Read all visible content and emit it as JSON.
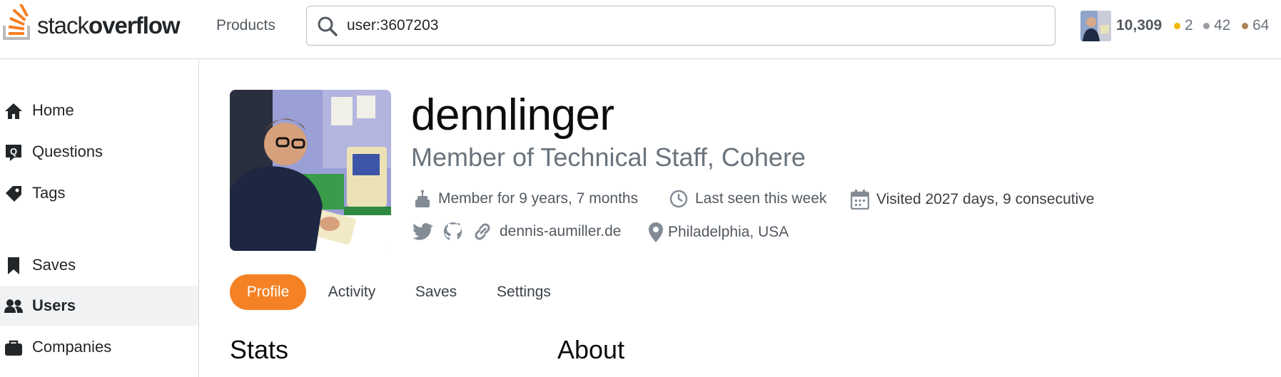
{
  "header": {
    "logo_light": "stack",
    "logo_bold": "overflow",
    "products_label": "Products",
    "search_value": "user:3607203",
    "reputation": "10,309",
    "badges": {
      "gold": "2",
      "silver": "42",
      "bronze": "64"
    }
  },
  "sidebar": {
    "items": [
      {
        "label": "Home"
      },
      {
        "label": "Questions"
      },
      {
        "label": "Tags"
      },
      {
        "label": "Saves"
      },
      {
        "label": "Users"
      },
      {
        "label": "Companies"
      }
    ]
  },
  "profile": {
    "name": "dennlinger",
    "title": "Member of Technical Staff, Cohere",
    "member_for": "Member for 9 years, 7 months",
    "last_seen": "Last seen this week",
    "visited": "Visited 2027 days, 9 consecutive",
    "website": "dennis-aumiller.de",
    "location": "Philadelphia, USA"
  },
  "tabs": [
    {
      "label": "Profile"
    },
    {
      "label": "Activity"
    },
    {
      "label": "Saves"
    },
    {
      "label": "Settings"
    }
  ],
  "sections": {
    "stats": "Stats",
    "about": "About"
  },
  "colors": {
    "brand_orange": "#f48225",
    "gold": "#f1b600",
    "silver": "#9a9fa5",
    "bronze": "#ab8259"
  }
}
